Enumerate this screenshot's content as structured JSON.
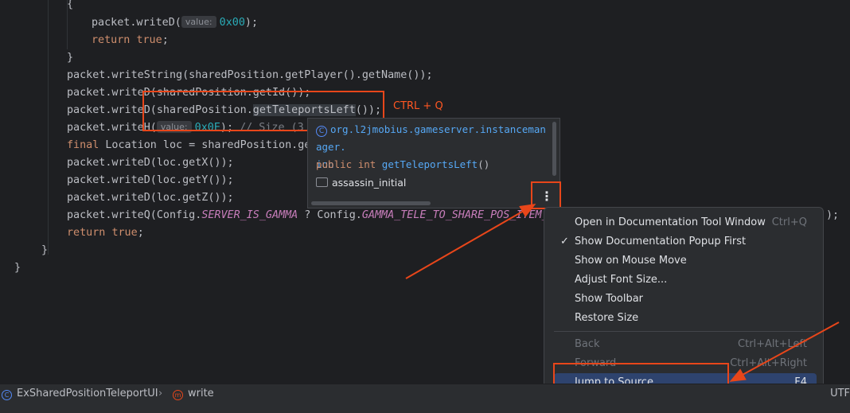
{
  "code": {
    "open_brace": "{",
    "l_writeD_start": "packet.writeD(",
    "hint_value": "value:",
    "val_0x00": "0x00",
    "close_semicolon": ");",
    "kw_return": "return",
    "kw_true": "true",
    "semicolon": ";",
    "close_brace": "}",
    "l_writeString": "packet.writeString(sharedPosition.getPlayer().getName());",
    "l_writeD_getId": "packet.writeD(sharedPosition.getId());",
    "l_writeD_tele_start": "packet.writeD(sharedPosition.",
    "l_writeD_tele_method": "getTeleportsLeft",
    "l_writeD_tele_end": "());",
    "l_writeH_start": "packet.writeH(",
    "val_0x0E": "0x0E",
    "comment_size": "// Size (3",
    "kw_final": "final",
    "l_location": " Location loc = sharedPosition.ge",
    "l_getX": "packet.writeD(loc.getX());",
    "l_getY": "packet.writeD(loc.getY());",
    "l_getZ": "packet.writeD(loc.getZ());",
    "l_writeQ_start": "packet.writeQ(Config.",
    "const_gamma_flag": "SERVER_IS_GAMMA",
    "l_writeQ_mid": " ? Config.",
    "const_gamma_tele": "GAMMA_TELE_TO_SHARE_POS_ITEM_",
    "tail_fragment": ");"
  },
  "annotation": {
    "shortcut_label": "CTRL + Q",
    "color": "#e8461a"
  },
  "doc_popup": {
    "class_icon": "C",
    "path": "org.l2jmobius.gameserver.instancemanager.",
    "path_wrap": "ion",
    "signature_public": "public",
    "signature_type": "int",
    "signature_method": "getTeleportsLeft",
    "signature_parens": "()",
    "module": "assassin_initial",
    "more_icon": "⋮"
  },
  "menu": {
    "items": [
      {
        "label": "Open in Documentation Tool Window",
        "shortcut": "Ctrl+Q"
      },
      {
        "label": "Show Documentation Popup First",
        "shortcut": "",
        "check": "✓"
      },
      {
        "label": "Show on Mouse Move",
        "shortcut": ""
      },
      {
        "label": "Adjust Font Size...",
        "shortcut": ""
      },
      {
        "label": "Show Toolbar",
        "shortcut": ""
      },
      {
        "label": "Restore Size",
        "shortcut": ""
      },
      {
        "label": "Back",
        "shortcut": "Ctrl+Alt+Left"
      },
      {
        "label": "Forward",
        "shortcut": "Ctrl+Alt+Right"
      },
      {
        "label": "Jump to Source",
        "shortcut": "F4"
      }
    ]
  },
  "breadcrumb": {
    "class_icon": "C",
    "class_name": "ExSharedPositionTeleportUI",
    "separator": "›",
    "method_icon": "m",
    "method_name": "write",
    "encoding": "UTF"
  }
}
